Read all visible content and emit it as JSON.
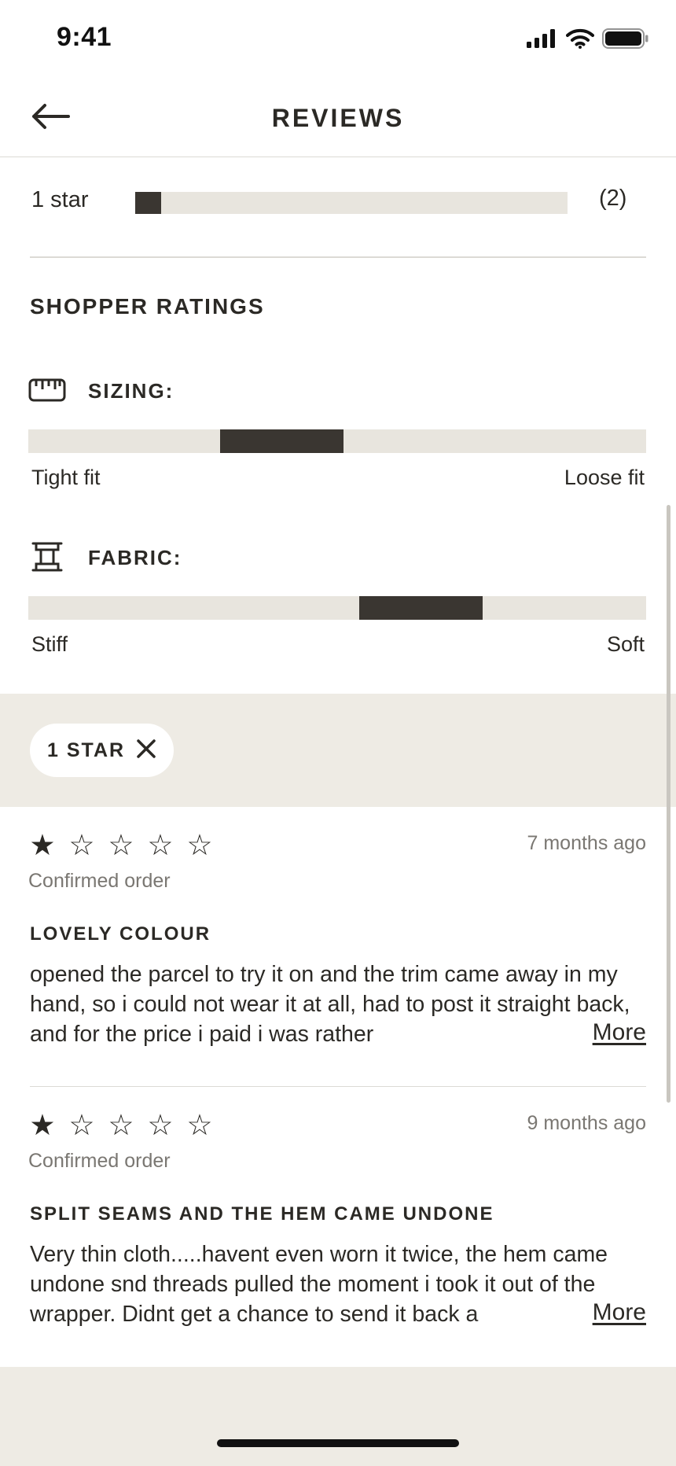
{
  "status_bar": {
    "time": "9:41",
    "icons": [
      "signal-icon",
      "wifi-icon",
      "battery-icon"
    ]
  },
  "nav": {
    "title": "REVIEWS",
    "back_icon": "back-arrow-icon"
  },
  "distribution": {
    "label": "1 star",
    "count": "(2)",
    "fill_fraction": 0.06
  },
  "shopper_ratings": {
    "heading": "SHOPPER RATINGS",
    "items": [
      {
        "icon": "tape-measure-icon",
        "title": "SIZING:",
        "min_label": "Tight fit",
        "max_label": "Loose fit",
        "marker_start": 0.31,
        "marker_end": 0.51
      },
      {
        "icon": "fabric-roll-icon",
        "title": "FABRIC:",
        "min_label": "Stiff",
        "max_label": "Soft",
        "marker_start": 0.535,
        "marker_end": 0.735
      }
    ]
  },
  "filter": {
    "chip_label": "1 STAR",
    "close_icon": "close-icon"
  },
  "reviews": [
    {
      "rating": 1,
      "max_rating": 5,
      "date": "7 months ago",
      "verified": "Confirmed order",
      "title": "LOVELY COLOUR",
      "body": "opened the parcel to try it on and the trim came away in my hand, so i could not wear it at all, had to post it straight back, and for the price i paid i was rather",
      "more": "More"
    },
    {
      "rating": 1,
      "max_rating": 5,
      "date": "9 months ago",
      "verified": "Confirmed order",
      "title": "SPLIT SEAMS AND THE HEM CAME UNDONE",
      "body": "Very thin cloth.....havent even worn it twice, the hem came undone snd threads pulled the moment i took it out of the wrapper. Didnt get a chance to send it back a",
      "more": "More"
    }
  ],
  "colors": {
    "accent_dark": "#3a3631",
    "track": "#e8e5de",
    "panel": "#eeebe4",
    "muted_text": "#7a7772"
  }
}
